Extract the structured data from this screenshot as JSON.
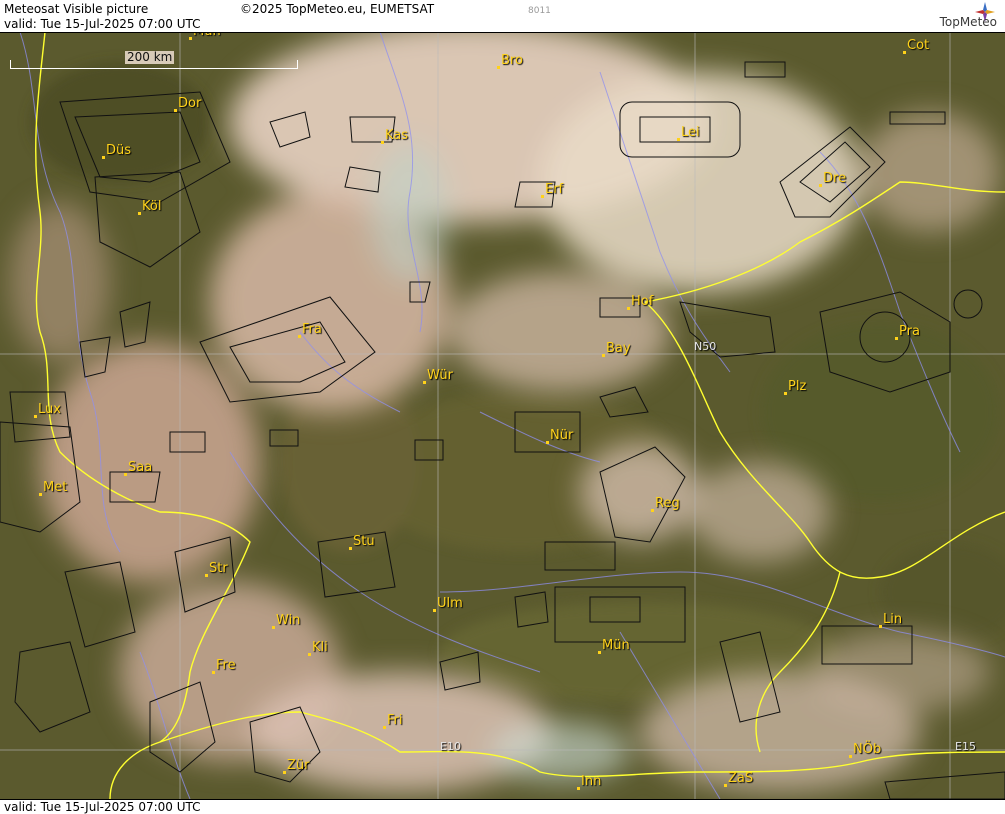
{
  "header": {
    "title": "Meteosat Visible picture",
    "valid": "valid:  Tue  15-Jul-2025  07:00 UTC",
    "copyright": "©2025 TopMeteo.eu, EUMETSAT",
    "code": "8011",
    "brand": "TopMeteo"
  },
  "footer": {
    "valid": "valid:  Tue  15-Jul-2025  07:00 UTC"
  },
  "map": {
    "scale_label": "200 km",
    "grid_labels": [
      "N50",
      "E10",
      "E15"
    ],
    "cities": [
      {
        "id": "mun-top",
        "name": "Mün"
      },
      {
        "id": "bro",
        "name": "Bro"
      },
      {
        "id": "cot",
        "name": "Cot"
      },
      {
        "id": "dor",
        "name": "Dor"
      },
      {
        "id": "kas",
        "name": "Kas"
      },
      {
        "id": "lei",
        "name": "Lei"
      },
      {
        "id": "dus",
        "name": "Düs"
      },
      {
        "id": "dre",
        "name": "Dre"
      },
      {
        "id": "erf",
        "name": "Erf"
      },
      {
        "id": "kol",
        "name": "Köl"
      },
      {
        "id": "hof",
        "name": "Hof"
      },
      {
        "id": "fra",
        "name": "Fra"
      },
      {
        "id": "pra",
        "name": "Pra"
      },
      {
        "id": "bay",
        "name": "Bay"
      },
      {
        "id": "wur",
        "name": "Wür"
      },
      {
        "id": "plz",
        "name": "Plz"
      },
      {
        "id": "lux",
        "name": "Lux"
      },
      {
        "id": "nur",
        "name": "Nür"
      },
      {
        "id": "saa",
        "name": "Saa"
      },
      {
        "id": "met",
        "name": "Met"
      },
      {
        "id": "reg",
        "name": "Reg"
      },
      {
        "id": "stu",
        "name": "Stu"
      },
      {
        "id": "str",
        "name": "Str"
      },
      {
        "id": "ulm",
        "name": "Ulm"
      },
      {
        "id": "win",
        "name": "Win"
      },
      {
        "id": "lin",
        "name": "Lin"
      },
      {
        "id": "kli",
        "name": "Kli"
      },
      {
        "id": "mun",
        "name": "Mün"
      },
      {
        "id": "fre",
        "name": "Fre"
      },
      {
        "id": "fri",
        "name": "Fri"
      },
      {
        "id": "nob",
        "name": "NÖb"
      },
      {
        "id": "zur",
        "name": "Zür"
      },
      {
        "id": "inn",
        "name": "Inn"
      },
      {
        "id": "zas",
        "name": "ZaS"
      }
    ]
  }
}
